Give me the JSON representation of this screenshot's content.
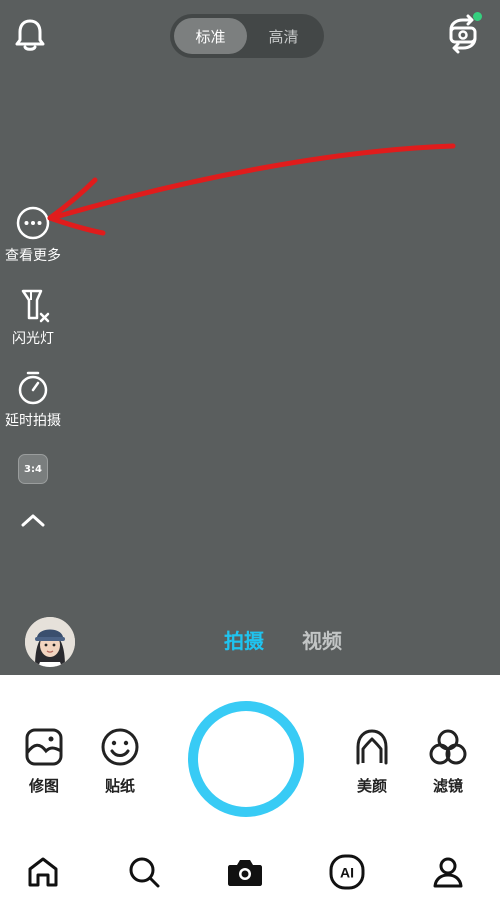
{
  "top_bar": {
    "notification_icon": "bell-icon",
    "quality_options": [
      "标准",
      "高清"
    ],
    "selected_quality": "标准",
    "flip_camera_icon": "camera-flip-icon",
    "flip_indicator_color": "#35d07f"
  },
  "side_tools": {
    "more_label": "查看更多",
    "flash_label": "闪光灯",
    "timer_label": "延时拍摄",
    "ratio_label": "3:4"
  },
  "modes": {
    "photo": "拍摄",
    "video": "视频",
    "active": "拍摄",
    "active_color": "#1fc4f0"
  },
  "controls": {
    "edit_label": "修图",
    "sticker_label": "贴纸",
    "beauty_label": "美颜",
    "filter_label": "滤镜",
    "shutter_color": "#38cbf5"
  },
  "bottom_nav": {
    "items": [
      "home-icon",
      "search-icon",
      "camera-icon",
      "ai-icon",
      "profile-icon"
    ],
    "ai_text": "AI"
  },
  "colors": {
    "viewfinder_bg": "#5a5e5e",
    "annotation_arrow": "#e01c1c"
  }
}
